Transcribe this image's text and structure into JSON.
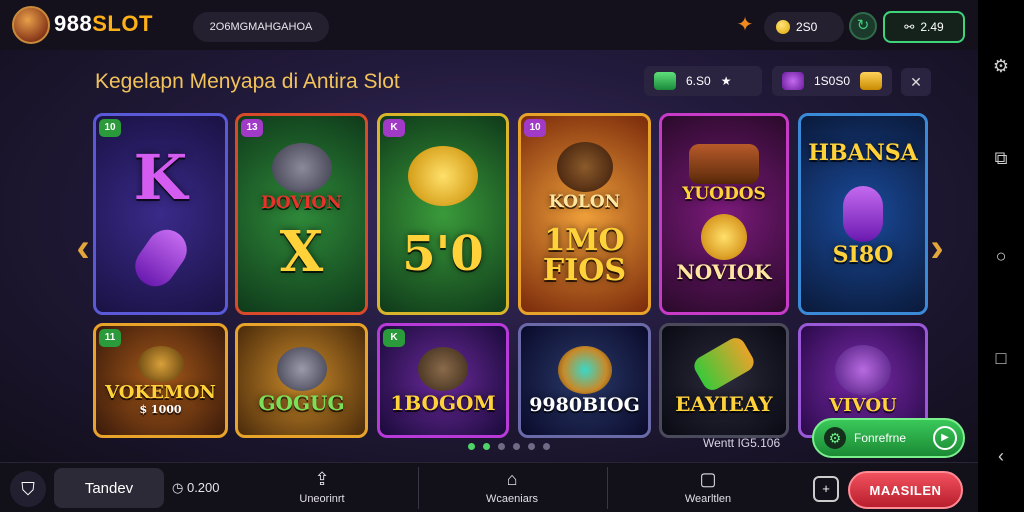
{
  "header": {
    "logo_text_white": "988",
    "logo_text_accent": "SLOT",
    "search_text": "2O6MGMAHGAHOA",
    "coin_balance": "2S0",
    "wallet_label": "2.49",
    "wallet_icon": "handshake-icon",
    "promo_icon": "star-badge-icon",
    "spin_icon": "refresh-icon"
  },
  "section": {
    "title": "Kegelapn Menyapa di Antira Slot",
    "chip_green_value": "6.S0",
    "chip_purple_value": "1S0S0"
  },
  "cards": [
    {
      "tag": "10",
      "label": "K",
      "sub": "",
      "theme": "purple"
    },
    {
      "tag": "13",
      "label": "DOVION",
      "sub": "X",
      "theme": "green"
    },
    {
      "tag": "K",
      "label": "",
      "sub": "5'0",
      "theme": "green2"
    },
    {
      "tag": "10",
      "label": "KOLON",
      "sub": "1MO FIOS",
      "theme": "orange"
    },
    {
      "tag": "",
      "label": "YUODOS",
      "sub": "NOVIOK",
      "theme": "magenta"
    },
    {
      "tag": "",
      "label": "HBANSA",
      "sub": "SI8O",
      "theme": "blue"
    },
    {
      "tag": "11",
      "label": "VOKEMON",
      "sub": "$ 1000",
      "theme": "amber"
    },
    {
      "tag": "",
      "label": "GOGUG",
      "sub": "",
      "theme": "gold"
    },
    {
      "tag": "K",
      "label": "1BOGOM",
      "sub": "",
      "theme": "violet"
    },
    {
      "tag": "",
      "label": "9980BIOG",
      "sub": "",
      "theme": "navy"
    },
    {
      "tag": "",
      "label": "EAYIEAY",
      "sub": "",
      "theme": "dark"
    },
    {
      "tag": "",
      "label": "VIVOU",
      "sub": "",
      "theme": "purple2"
    }
  ],
  "pager": {
    "count": 6,
    "active": 1
  },
  "ticker_text": "Wentt IG5.106",
  "bonus_button": "Fonrefrne",
  "bottom": {
    "username": "Tandev",
    "balance": "0.200",
    "nav": [
      "Uneorinrt",
      "Wcaeniars",
      "Wearltlen"
    ],
    "cta": "MAASILEN"
  },
  "colors": {
    "accent": "#ffb018",
    "green": "#3fd47a",
    "cta": "#e33b4a",
    "title": "#f2c35a"
  }
}
